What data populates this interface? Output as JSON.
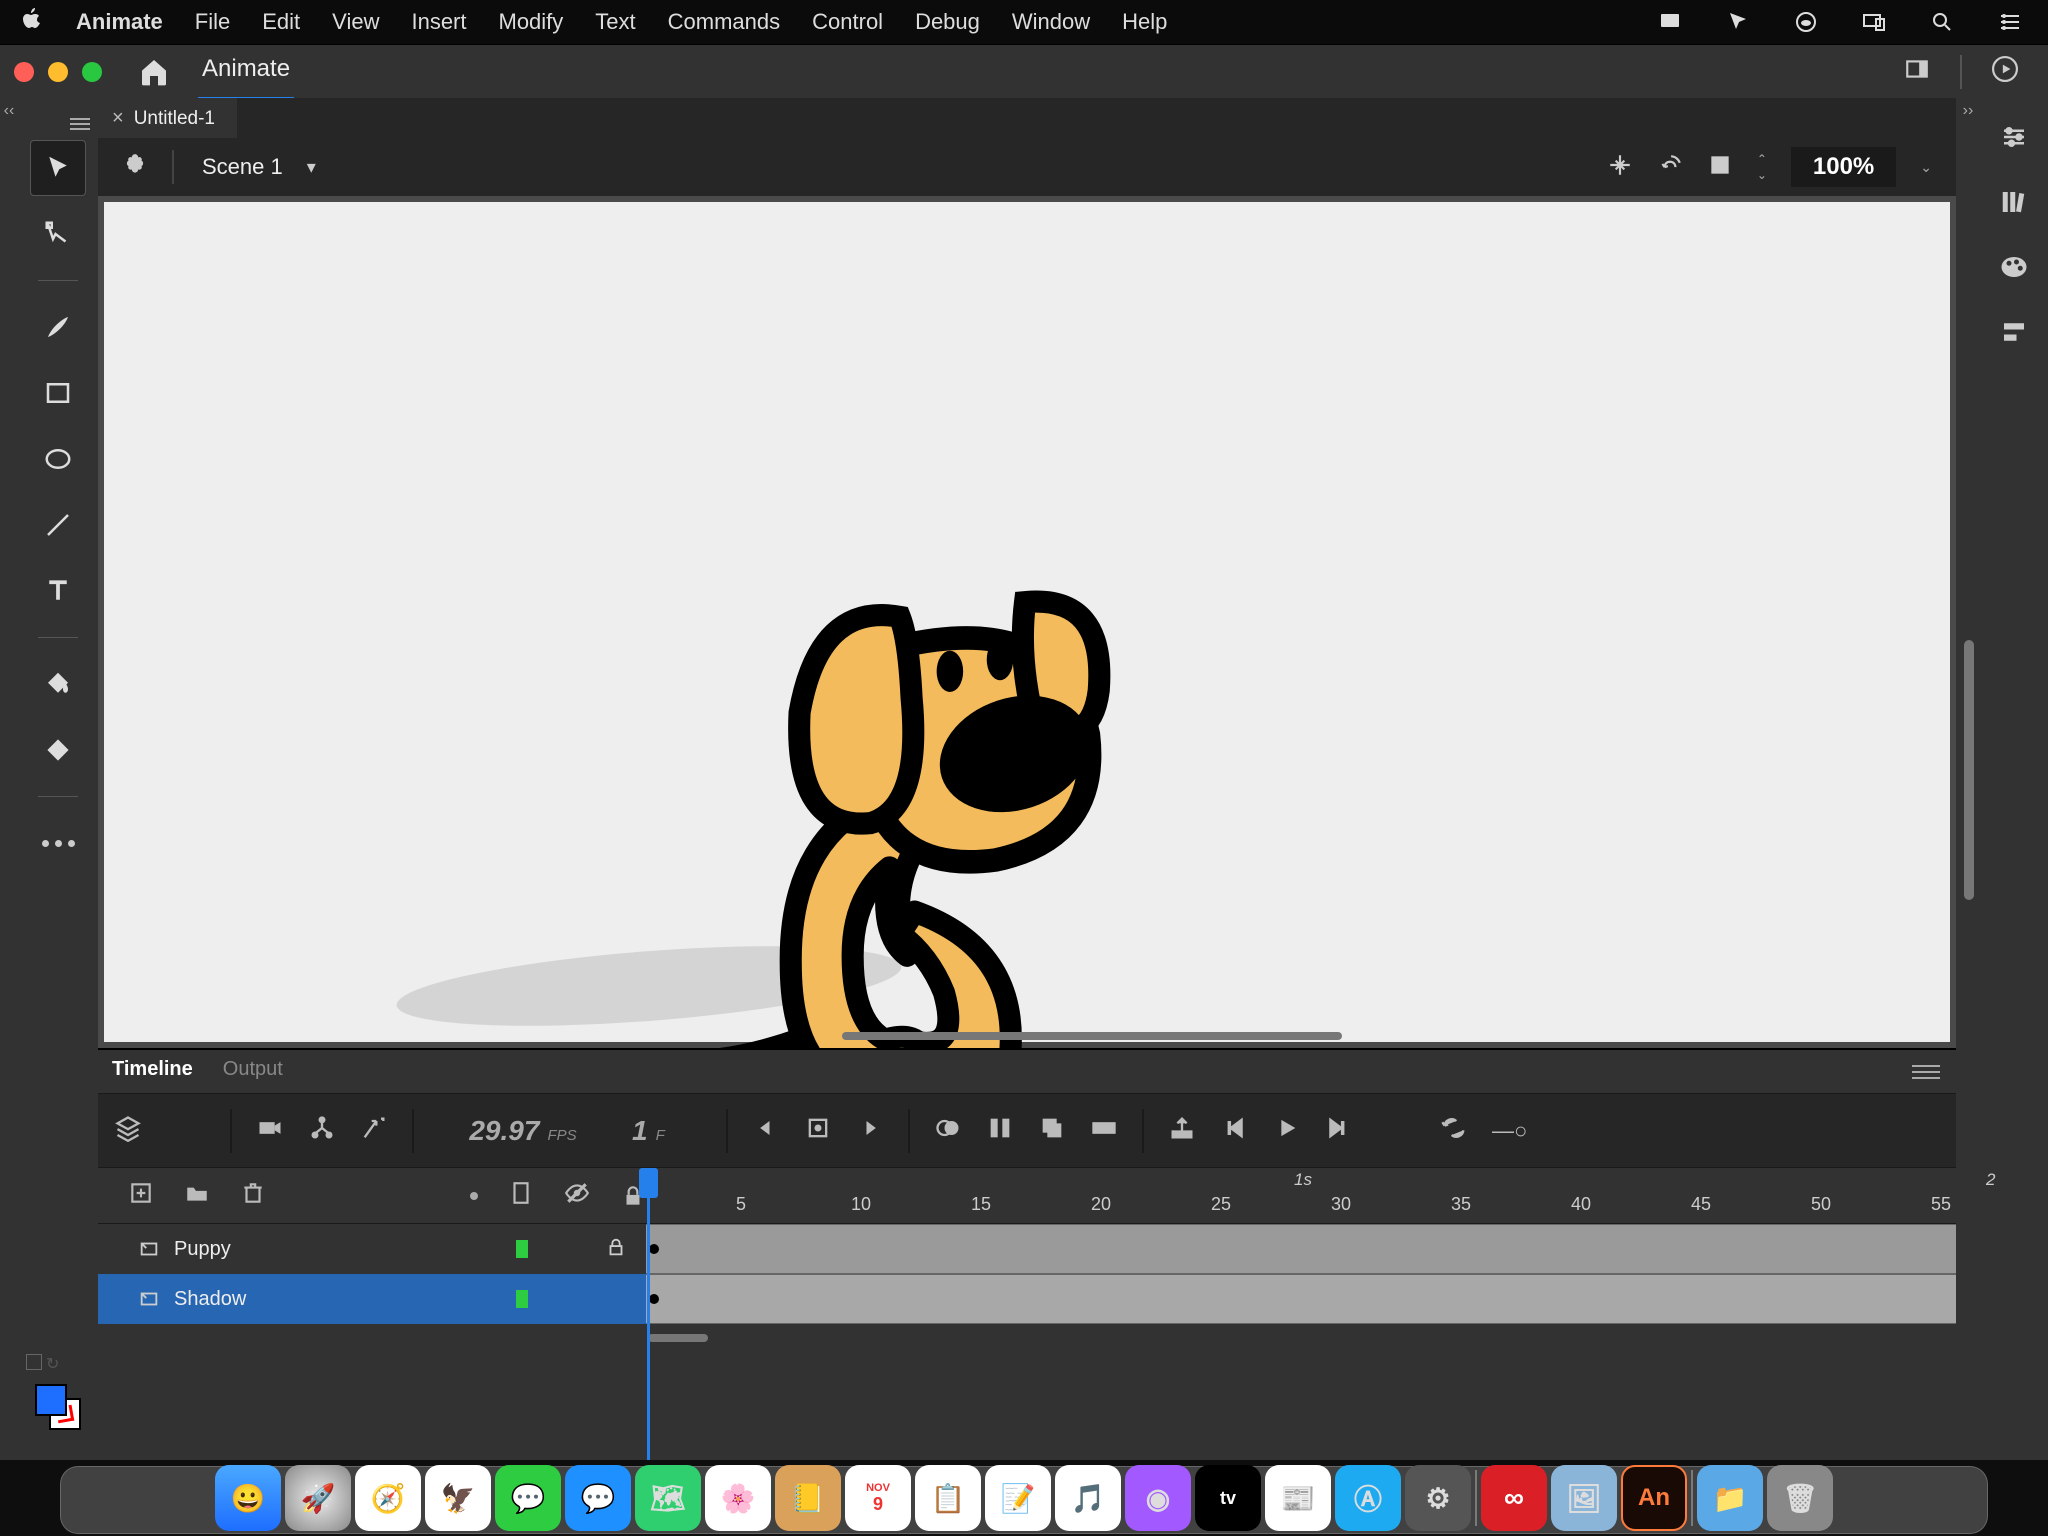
{
  "menubar": {
    "app": "Animate",
    "items": [
      "File",
      "Edit",
      "View",
      "Insert",
      "Modify",
      "Text",
      "Commands",
      "Control",
      "Debug",
      "Window",
      "Help"
    ]
  },
  "window": {
    "breadcrumb": "Animate"
  },
  "document": {
    "tab": "Untitled-1",
    "scene": "Scene 1",
    "zoom": "100%"
  },
  "timeline": {
    "tabs": [
      "Timeline",
      "Output"
    ],
    "active_tab": "Timeline",
    "fps_value": "29.97",
    "fps_label": "FPS",
    "frame_value": "1",
    "frame_label": "F",
    "ruler_marks": [
      "5",
      "10",
      "15",
      "20",
      "25",
      "30",
      "35",
      "40",
      "45",
      "50",
      "55"
    ],
    "second_marks": [
      "1s",
      "2"
    ],
    "layers": [
      {
        "name": "Puppy",
        "locked": true,
        "selected": false
      },
      {
        "name": "Shadow",
        "locked": false,
        "selected": true
      }
    ]
  },
  "dock": [
    "Finder",
    "Launchpad",
    "Safari",
    "Mail",
    "Messages",
    "Messages2",
    "Maps",
    "Photos",
    "Contacts",
    "Calendar",
    "Reminders",
    "Notes",
    "Music",
    "Podcasts",
    "TV",
    "News",
    "AppStore",
    "Settings",
    "",
    "CC",
    "Preview",
    "Animate",
    "",
    "Downloads",
    "Trash"
  ]
}
